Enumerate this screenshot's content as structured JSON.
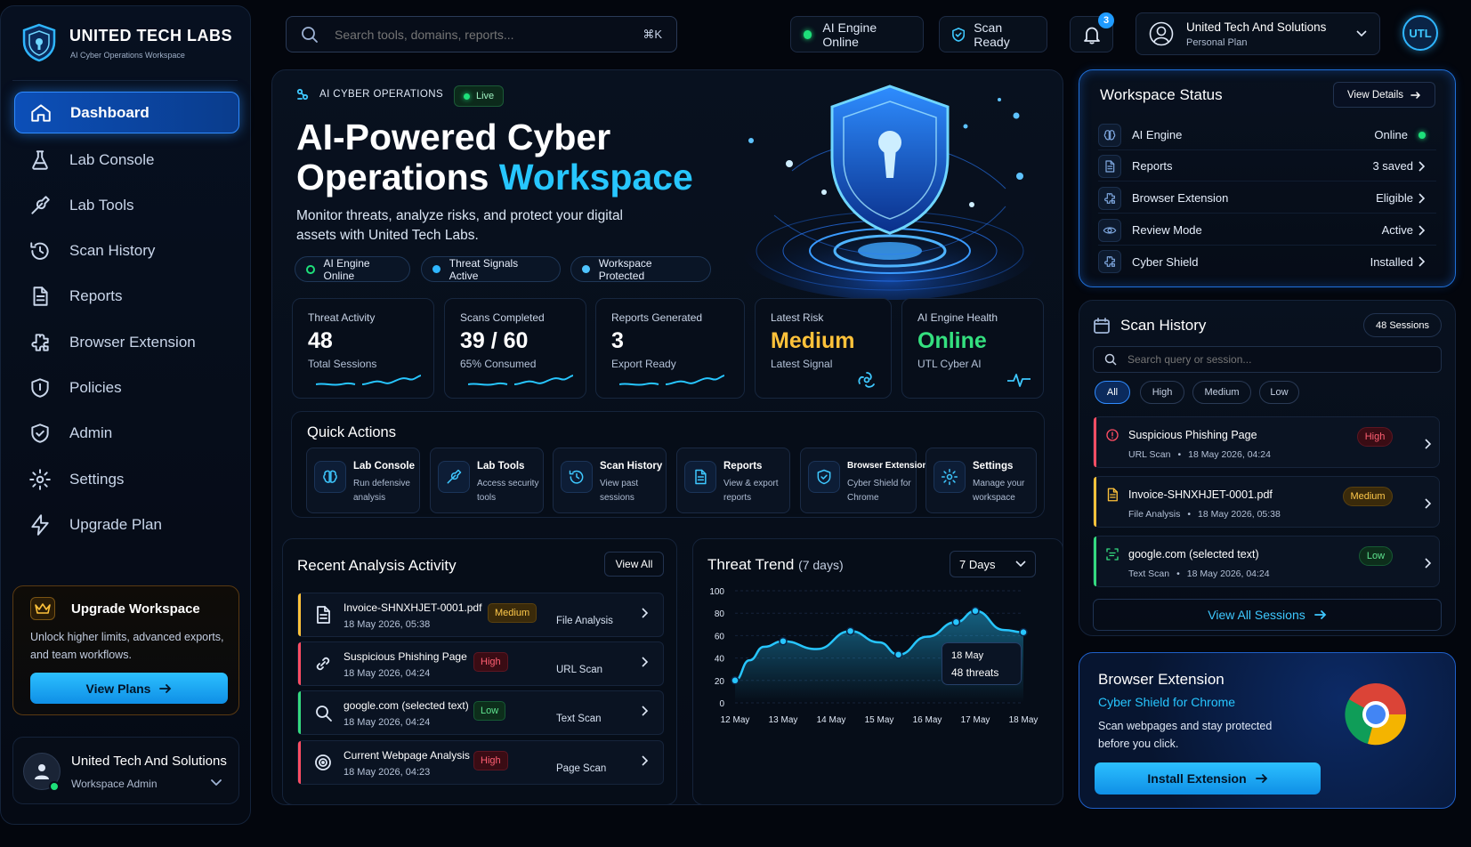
{
  "brand": {
    "name": "UNITED TECH LABS",
    "subtitle": "AI Cyber Operations Workspace"
  },
  "sidebar": {
    "items": [
      {
        "label": "Dashboard",
        "icon": "home-icon",
        "active": true
      },
      {
        "label": "Lab Console",
        "icon": "flask-icon"
      },
      {
        "label": "Lab Tools",
        "icon": "wrench-icon"
      },
      {
        "label": "Scan History",
        "icon": "history-icon"
      },
      {
        "label": "Reports",
        "icon": "document-icon"
      },
      {
        "label": "Browser Extension",
        "icon": "puzzle-icon"
      },
      {
        "label": "Policies",
        "icon": "shield-icon"
      },
      {
        "label": "Admin",
        "icon": "shield-check-icon"
      },
      {
        "label": "Settings",
        "icon": "gear-icon"
      },
      {
        "label": "Upgrade Plan",
        "icon": "bolt-icon"
      }
    ],
    "upgrade": {
      "title": "Upgrade Workspace",
      "text": "Unlock higher limits, advanced exports, and team workflows.",
      "button": "View Plans"
    },
    "user": {
      "name": "United Tech And Solutions",
      "role": "Workspace Admin"
    }
  },
  "topbar": {
    "search_placeholder": "Search tools, domains, reports...",
    "shortcut": "⌘K",
    "status1": "AI Engine Online",
    "status2": "Scan Ready",
    "notifications": "3",
    "account_name": "United Tech And Solutions",
    "account_plan": "Personal Plan",
    "avatar_initials": "UTL"
  },
  "hero": {
    "eyebrow": "AI CYBER OPERATIONS",
    "live": "Live",
    "title_line1": "AI-Powered Cyber",
    "title_line2a": "Operations ",
    "title_line2b": "Workspace",
    "description": "Monitor threats, analyze risks, and protect your digital assets with United Tech Labs.",
    "chips": [
      "AI Engine Online",
      "Threat Signals Active",
      "Workspace Protected"
    ]
  },
  "stats": [
    {
      "label": "Threat Activity",
      "value": "48",
      "sub": "Total Sessions"
    },
    {
      "label": "Scans Completed",
      "value": "39 / 60",
      "sub": "65% Consumed"
    },
    {
      "label": "Reports Generated",
      "value": "3",
      "sub": "Export Ready"
    },
    {
      "label": "Latest Risk",
      "value": "Medium",
      "sub": "Latest Signal"
    },
    {
      "label": "AI Engine Health",
      "value": "Online",
      "sub": "UTL Cyber AI"
    }
  ],
  "quick_actions": {
    "title": "Quick Actions",
    "items": [
      {
        "title": "Lab Console",
        "sub": "Run defensive analysis"
      },
      {
        "title": "Lab Tools",
        "sub": "Access security tools"
      },
      {
        "title": "Scan History",
        "sub": "View past sessions"
      },
      {
        "title": "Reports",
        "sub": "View & export reports"
      },
      {
        "title": "Browser Extension",
        "sub": "Cyber Shield for Chrome"
      },
      {
        "title": "Settings",
        "sub": "Manage your workspace"
      }
    ]
  },
  "recent": {
    "title": "Recent Analysis Activity",
    "view_all": "View All",
    "rows": [
      {
        "title": "Invoice-SHNXHJET-0001.pdf",
        "date": "18 May 2026, 05:38",
        "severity": "Medium",
        "type": "File Analysis"
      },
      {
        "title": "Suspicious Phishing Page",
        "date": "18 May 2026, 04:24",
        "severity": "High",
        "type": "URL Scan"
      },
      {
        "title": "google.com (selected text)",
        "date": "18 May 2026, 04:24",
        "severity": "Low",
        "type": "Text Scan"
      },
      {
        "title": "Current Webpage Analysis",
        "date": "18 May 2026, 04:23",
        "severity": "High",
        "type": "Page Scan"
      }
    ]
  },
  "trend": {
    "title": "Threat Trend",
    "range_note": "(7 days)",
    "dropdown": "7 Days",
    "tooltip_date": "18 May",
    "tooltip_value": "48 threats"
  },
  "chart_data": {
    "type": "area",
    "x": [
      "12 May",
      "13 May",
      "14 May",
      "15 May",
      "16 May",
      "17 May",
      "18 May"
    ],
    "y_ticks": [
      0,
      20,
      40,
      60,
      80,
      100
    ],
    "ylim": [
      0,
      100
    ],
    "points": [
      {
        "x": 12.0,
        "y": 20
      },
      {
        "x": 12.3,
        "y": 38
      },
      {
        "x": 12.6,
        "y": 50
      },
      {
        "x": 13.0,
        "y": 55
      },
      {
        "x": 13.7,
        "y": 48
      },
      {
        "x": 14.4,
        "y": 64
      },
      {
        "x": 15.0,
        "y": 54
      },
      {
        "x": 15.4,
        "y": 43
      },
      {
        "x": 16.0,
        "y": 59
      },
      {
        "x": 16.6,
        "y": 72
      },
      {
        "x": 17.0,
        "y": 82
      },
      {
        "x": 17.6,
        "y": 65
      },
      {
        "x": 18.0,
        "y": 63
      }
    ],
    "grid": true
  },
  "workspace": {
    "title": "Workspace Status",
    "view_details": "View Details",
    "rows": [
      {
        "label": "AI Engine",
        "value": "Online"
      },
      {
        "label": "Reports",
        "value": "3 saved"
      },
      {
        "label": "Browser Extension",
        "value": "Eligible"
      },
      {
        "label": "Review Mode",
        "value": "Active"
      },
      {
        "label": "Cyber Shield",
        "value": "Installed"
      }
    ]
  },
  "scan_history": {
    "title": "Scan History",
    "count": "48 Sessions",
    "search_placeholder": "Search query or session...",
    "filters": [
      "All",
      "High",
      "Medium",
      "Low"
    ],
    "rows": [
      {
        "title": "Suspicious Phishing Page",
        "type": "URL Scan",
        "date": "18 May 2026, 04:24",
        "severity": "High"
      },
      {
        "title": "Invoice-SHNXHJET-0001.pdf",
        "type": "File Analysis",
        "date": "18 May 2026, 05:38",
        "severity": "Medium"
      },
      {
        "title": "google.com (selected text)",
        "type": "Text Scan",
        "date": "18 May 2026, 04:24",
        "severity": "Low"
      }
    ],
    "view_all": "View All Sessions"
  },
  "extension": {
    "title": "Browser Extension",
    "subtitle": "Cyber Shield for Chrome",
    "text": "Scan webpages and stay protected before you click.",
    "button": "Install Extension"
  },
  "colors": {
    "accent": "#27c6ff",
    "high": "#ff4d63",
    "medium": "#ffc23a",
    "low": "#34d97f",
    "online": "#1ee07a"
  }
}
